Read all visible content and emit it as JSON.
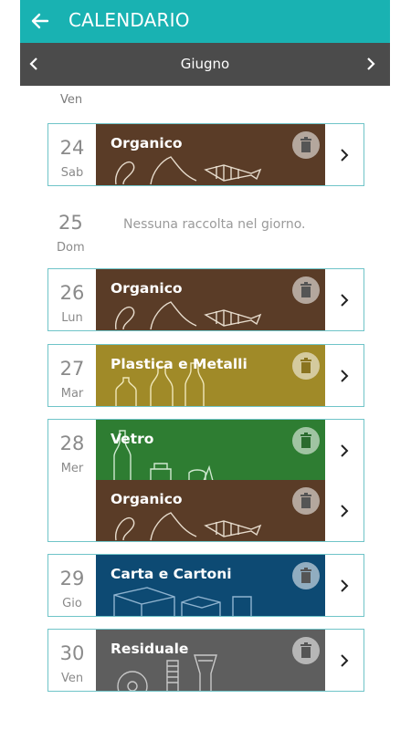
{
  "header": {
    "title": "CALENDARIO",
    "back_icon": "arrow-left-icon"
  },
  "month_nav": {
    "label": "Giugno"
  },
  "top_day": {
    "dow": "Ven"
  },
  "days": [
    {
      "num": "24",
      "dow": "Sab",
      "entries": [
        {
          "label": "Organico",
          "type": "org"
        }
      ]
    },
    {
      "num": "25",
      "dow": "Dom",
      "empty_message": "Nessuna raccolta nel giorno."
    },
    {
      "num": "26",
      "dow": "Lun",
      "entries": [
        {
          "label": "Organico",
          "type": "org"
        }
      ]
    },
    {
      "num": "27",
      "dow": "Mar",
      "entries": [
        {
          "label": "Plastica e Metalli",
          "type": "pla"
        }
      ]
    },
    {
      "num": "28",
      "dow": "Mer",
      "entries": [
        {
          "label": "Vetro",
          "type": "vet"
        },
        {
          "label": "Organico",
          "type": "org"
        }
      ]
    },
    {
      "num": "29",
      "dow": "Gio",
      "entries": [
        {
          "label": "Carta e Cartoni",
          "type": "car"
        }
      ]
    },
    {
      "num": "30",
      "dow": "Ven",
      "entries": [
        {
          "label": "Residuale",
          "type": "res"
        }
      ]
    }
  ],
  "colors": {
    "topbar": "#19b2b2",
    "monthbar": "#4b4b4b",
    "organico": "#5a3c27",
    "plastica": "#a08a28",
    "vetro": "#2e7d32",
    "carta": "#0d4a73",
    "residuale": "#5e5e5e",
    "border": "#6fc4c8"
  }
}
